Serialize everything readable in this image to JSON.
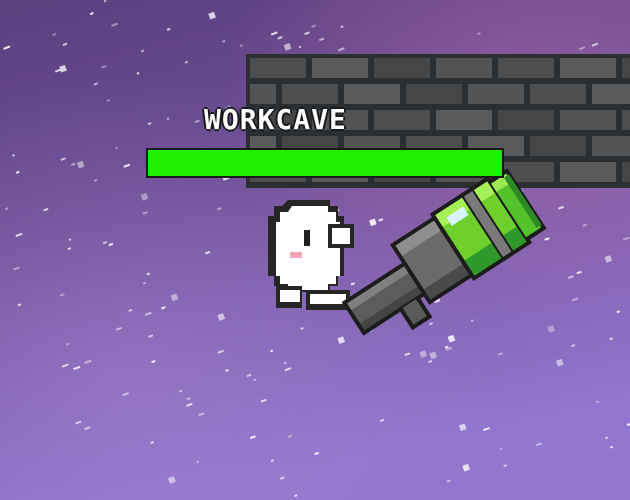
{
  "player": {
    "name": "WORKCAVE",
    "health_fraction": 1.0,
    "weapon": "rocket-launcher-icon"
  },
  "colors": {
    "health_bar": "#22ee00",
    "space_top": "#6a4a8e",
    "space_bottom": "#8e6fc4",
    "brick_wall": "#4a4a4a"
  }
}
